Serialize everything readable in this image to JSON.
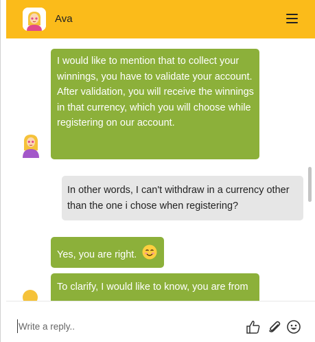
{
  "header": {
    "agent_name": "Ava",
    "avatar_icon": "female-agent-avatar-icon",
    "menu_icon": "hamburger-menu-icon",
    "background_color": "#fbbb1a"
  },
  "messages": [
    {
      "sender": "agent",
      "text": "I would like to mention that to collect your winnings, you have to validate your account. After validation, you will receive the winnings in that currency, which you will choose while registering on our account."
    },
    {
      "sender": "user",
      "text": "In other words, I can't withdraw in a currency other than the one i chose when registering?"
    },
    {
      "sender": "agent",
      "text": "Yes, you are right.",
      "emoji": "smiling-face-icon"
    },
    {
      "sender": "agent",
      "text": "To clarify, I would like to know, you are from"
    }
  ],
  "composer": {
    "placeholder": "Write a reply..",
    "value": "",
    "tools": [
      "thumbs-up-icon",
      "paperclip-icon",
      "emoji-icon"
    ]
  },
  "colors": {
    "agent_bubble": "#8cb03a",
    "user_bubble": "#e6e6e6",
    "accent": "#fbbb1a"
  }
}
